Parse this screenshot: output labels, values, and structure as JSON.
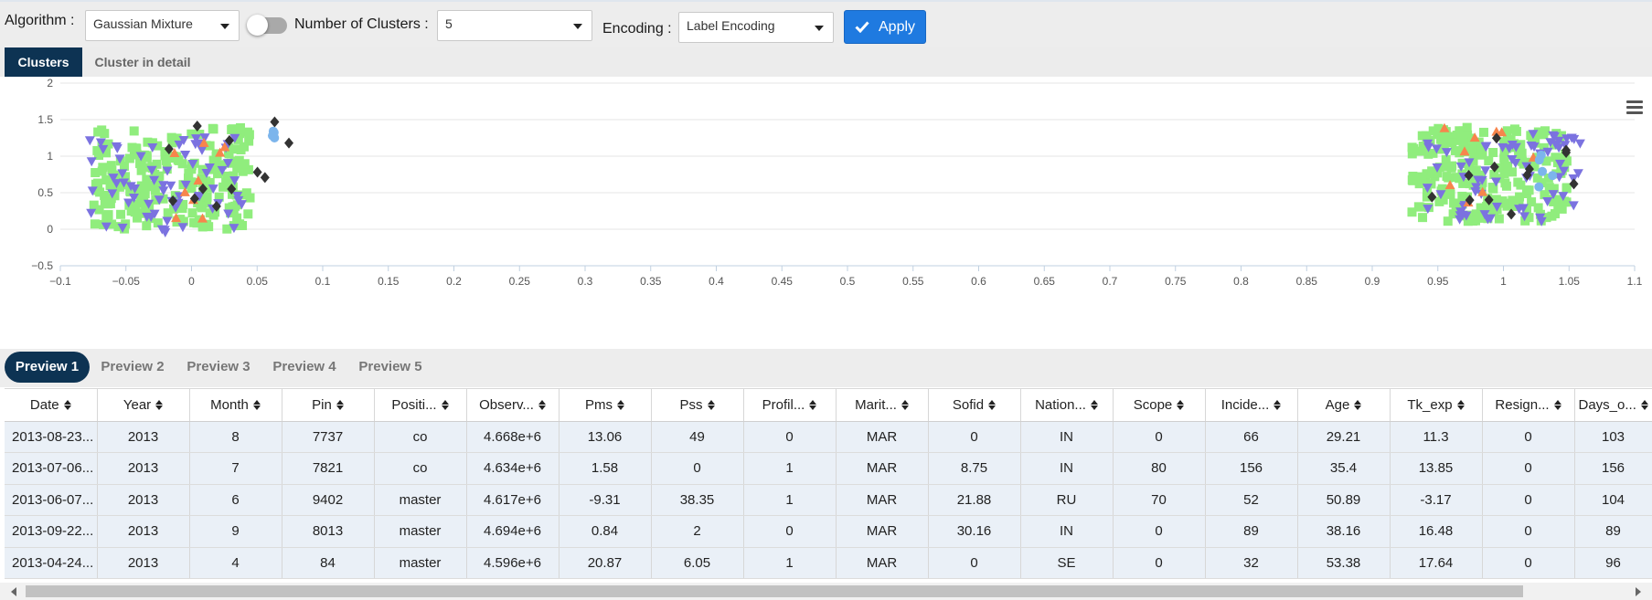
{
  "toolbar": {
    "algorithm_label": "Algorithm :",
    "algorithm_value": "Gaussian Mixture",
    "clusters_label": "Number of Clusters :",
    "clusters_value": "5",
    "encoding_label": "Encoding :",
    "encoding_value": "Label Encoding",
    "apply_label": "Apply"
  },
  "tabs": [
    {
      "label": "Clusters",
      "active": true
    },
    {
      "label": "Cluster in detail",
      "active": false
    }
  ],
  "chart_data": {
    "type": "scatter",
    "xlim": [
      -0.1,
      1.1
    ],
    "ylim": [
      -0.5,
      2
    ],
    "x_ticks": [
      "−0.1",
      "−0.05",
      "0",
      "0.05",
      "0.1",
      "0.15",
      "0.2",
      "0.25",
      "0.3",
      "0.35",
      "0.4",
      "0.45",
      "0.5",
      "0.55",
      "0.6",
      "0.65",
      "0.7",
      "0.75",
      "0.8",
      "0.85",
      "0.9",
      "0.95",
      "1",
      "1.05",
      "1.1"
    ],
    "y_ticks": [
      "−0.5",
      "0",
      "0.5",
      "1",
      "1.5",
      "2"
    ],
    "grid": true,
    "series": [
      {
        "marker": "square",
        "color": "#90ed7d",
        "clusters": [
          {
            "cx": -0.015,
            "cy": 0.7,
            "w": 0.12,
            "h": 1.4
          },
          {
            "cx": 0.99,
            "cy": 0.75,
            "w": 0.12,
            "h": 1.3
          }
        ]
      },
      {
        "marker": "triangle-down",
        "color": "#7b72e0",
        "clusters": [
          {
            "cx": -0.02,
            "cy": 0.6,
            "w": 0.12,
            "h": 1.3
          },
          {
            "cx": 1.0,
            "cy": 0.7,
            "w": 0.12,
            "h": 1.2
          }
        ]
      },
      {
        "marker": "triangle",
        "color": "#f7854c",
        "clusters": [
          {
            "cx": 0.0,
            "cy": 0.7,
            "w": 0.06,
            "h": 1.2
          },
          {
            "cx": 0.99,
            "cy": 0.8,
            "w": 0.08,
            "h": 1.2
          }
        ]
      },
      {
        "marker": "diamond",
        "color": "#333333",
        "clusters": [
          {
            "cx": 0.03,
            "cy": 0.9,
            "w": 0.1,
            "h": 1.2
          },
          {
            "cx": 1.0,
            "cy": 0.8,
            "w": 0.12,
            "h": 1.3
          }
        ]
      },
      {
        "marker": "circle",
        "color": "#7cb5ec",
        "clusters": [
          {
            "cx": 0.06,
            "cy": 1.3,
            "w": 0.01,
            "h": 0.2
          },
          {
            "cx": 1.04,
            "cy": 0.8,
            "w": 0.03,
            "h": 1.1
          }
        ]
      }
    ]
  },
  "preview_tabs": [
    {
      "label": "Preview 1",
      "active": true
    },
    {
      "label": "Preview 2",
      "active": false
    },
    {
      "label": "Preview 3",
      "active": false
    },
    {
      "label": "Preview 4",
      "active": false
    },
    {
      "label": "Preview 5",
      "active": false
    }
  ],
  "table": {
    "columns": [
      "Date",
      "Year",
      "Month",
      "Pin",
      "Positi...",
      "Observ...",
      "Pms",
      "Pss",
      "Profil...",
      "Marit...",
      "Sofid",
      "Nation...",
      "Scope",
      "Incide...",
      "Age",
      "Tk_exp",
      "Resign...",
      "Days_o..."
    ],
    "rows": [
      [
        "2013-08-23...",
        "2013",
        "8",
        "7737",
        "co",
        "4.668e+6",
        "13.06",
        "49",
        "0",
        "MAR",
        "0",
        "IN",
        "0",
        "66",
        "29.21",
        "11.3",
        "0",
        "103"
      ],
      [
        "2013-07-06...",
        "2013",
        "7",
        "7821",
        "co",
        "4.634e+6",
        "1.58",
        "0",
        "1",
        "MAR",
        "8.75",
        "IN",
        "80",
        "156",
        "35.4",
        "13.85",
        "0",
        "156"
      ],
      [
        "2013-06-07...",
        "2013",
        "6",
        "9402",
        "master",
        "4.617e+6",
        "-9.31",
        "38.35",
        "1",
        "MAR",
        "21.88",
        "RU",
        "70",
        "52",
        "50.89",
        "-3.17",
        "0",
        "104"
      ],
      [
        "2013-09-22...",
        "2013",
        "9",
        "8013",
        "master",
        "4.694e+6",
        "0.84",
        "2",
        "0",
        "MAR",
        "30.16",
        "IN",
        "0",
        "89",
        "38.16",
        "16.48",
        "0",
        "89"
      ],
      [
        "2013-04-24...",
        "2013",
        "4",
        "84",
        "master",
        "4.596e+6",
        "20.87",
        "6.05",
        "1",
        "MAR",
        "0",
        "SE",
        "0",
        "32",
        "53.38",
        "17.64",
        "0",
        "96"
      ]
    ]
  }
}
